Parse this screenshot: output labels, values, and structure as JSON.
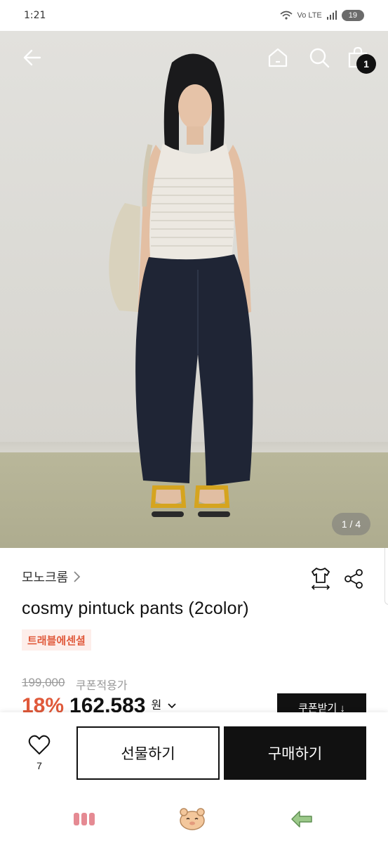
{
  "status_bar": {
    "time": "1:21",
    "network": "Vo LTE",
    "battery": "19"
  },
  "header": {
    "back_icon": "arrow-left-icon",
    "home_icon": "home-icon",
    "search_icon": "search-icon",
    "cart_icon": "shopping-bag-icon",
    "cart_count": "1"
  },
  "gallery": {
    "counter": "1 / 4"
  },
  "product": {
    "brand": "모노크롬",
    "brand_chevron": "chevron-right-icon",
    "title": "cosmy pintuck pants (2color)",
    "tag": "트래블에센셜",
    "original_price": "199,000",
    "coupon_note": "쿠폰적용가",
    "discount": "18%",
    "sale_price": "162,583",
    "won": "원",
    "coupon_button": "쿠폰받기 ↓"
  },
  "action_bar": {
    "like_count": "7",
    "gift_label": "선물하기",
    "buy_label": "구매하기"
  },
  "colors": {
    "accent": "#e0593a",
    "tag_bg": "#fdeeea",
    "primary": "#111111"
  }
}
